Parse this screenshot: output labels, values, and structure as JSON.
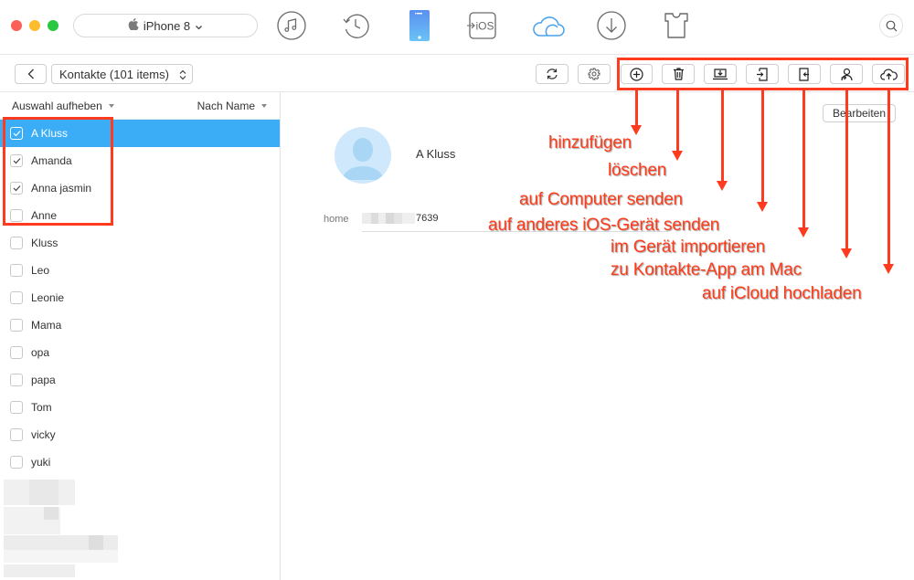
{
  "window": {
    "traffic_lights": {
      "close": "#fc5f57",
      "minimize": "#fdbc2e",
      "maximize": "#28c840"
    },
    "device_selector": {
      "label": "iPhone 8",
      "icon": "apple-icon"
    }
  },
  "top_nav": [
    {
      "name": "music",
      "icon": "music-note-icon"
    },
    {
      "name": "history",
      "icon": "history-clock-icon"
    },
    {
      "name": "device",
      "icon": "iphone-icon",
      "active": true
    },
    {
      "name": "to-ios",
      "icon": "to-ios-icon",
      "label": "iOS"
    },
    {
      "name": "icloud",
      "icon": "cloud-icon"
    },
    {
      "name": "download",
      "icon": "download-icon"
    },
    {
      "name": "toolkit",
      "icon": "tshirt-icon"
    }
  ],
  "search": {
    "icon": "search-icon"
  },
  "toolbar": {
    "back_icon": "chevron-left-icon",
    "category": "Kontakte (101 items)",
    "refresh_icon": "refresh-icon",
    "settings_icon": "gear-icon",
    "actions": [
      {
        "id": "add",
        "icon": "plus-circle-icon"
      },
      {
        "id": "delete",
        "icon": "trash-icon"
      },
      {
        "id": "to-computer",
        "icon": "to-computer-icon"
      },
      {
        "id": "to-device",
        "icon": "to-device-icon"
      },
      {
        "id": "import",
        "icon": "import-icon"
      },
      {
        "id": "to-contacts-app",
        "icon": "contacts-app-icon"
      },
      {
        "id": "to-icloud",
        "icon": "cloud-upload-icon"
      }
    ]
  },
  "sidebar": {
    "deselect_label": "Auswahl aufheben",
    "sort_label": "Nach Name",
    "contacts": [
      {
        "name": "A Kluss",
        "checked": true,
        "selected": true
      },
      {
        "name": "Amanda",
        "checked": true
      },
      {
        "name": "Anna jasmin",
        "checked": true
      },
      {
        "name": "Anne",
        "checked": false
      },
      {
        "name": "Kluss",
        "checked": false
      },
      {
        "name": "Leo",
        "checked": false
      },
      {
        "name": "Leonie",
        "checked": false
      },
      {
        "name": "Mama",
        "checked": false
      },
      {
        "name": "opa",
        "checked": false
      },
      {
        "name": "papa",
        "checked": false
      },
      {
        "name": "Tom",
        "checked": false
      },
      {
        "name": "vicky",
        "checked": false
      },
      {
        "name": "yuki",
        "checked": false
      }
    ]
  },
  "detail": {
    "edit_label": "Bearbeiten",
    "contact_name": "A Kluss",
    "field_label": "home",
    "field_value_visible": "7639"
  },
  "annotations": {
    "color": "#ff3b1f",
    "labels": [
      "hinzufügen",
      "löschen",
      "auf Computer senden",
      "auf anderes iOS-Gerät senden",
      "im Gerät importieren",
      "zu Kontakte-App am Mac",
      "auf iCloud hochladen"
    ]
  }
}
